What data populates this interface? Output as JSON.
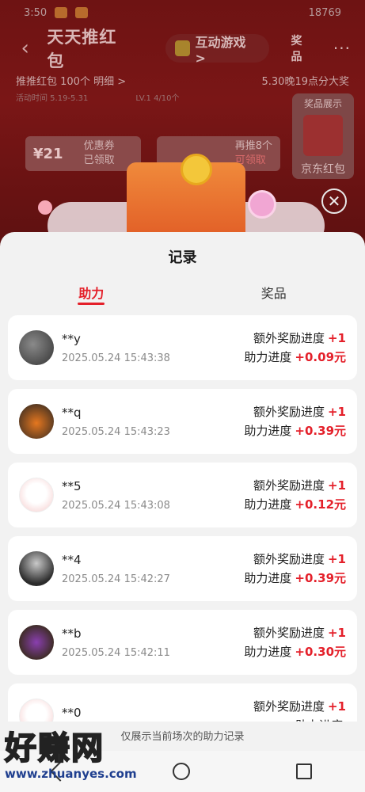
{
  "statusbar": {
    "time": "3:50",
    "battery": "18769"
  },
  "bg": {
    "title": "天天推红包",
    "game_btn": "互动游戏 >",
    "prize_btn": "奖品",
    "more": "···",
    "info_left": "推推红包 100个 明细 >",
    "info_right": "5.30晚19点分大奖",
    "activity_time": "活动时间 5.19-5.31",
    "level": "LV.1 4/10个",
    "coupon_amount": "¥21",
    "coupon_label": "优惠券",
    "coupon_status": "已领取",
    "coupon2_top": "再推8个",
    "coupon2_status": "可领取",
    "prize_side_title": "奖品展示",
    "prize_side_label": "京东红包"
  },
  "sheet": {
    "title": "记录",
    "tabs": [
      "助力",
      "奖品"
    ],
    "extra_label": "额外奖励进度",
    "help_label": "助力进度",
    "records": [
      {
        "name": "**y",
        "time": "2025.05.24 15:43:38",
        "extra": "+1",
        "help": "+0.09元"
      },
      {
        "name": "**q",
        "time": "2025.05.24 15:43:23",
        "extra": "+1",
        "help": "+0.39元"
      },
      {
        "name": "**5",
        "time": "2025.05.24 15:43:08",
        "extra": "+1",
        "help": "+0.12元"
      },
      {
        "name": "**4",
        "time": "2025.05.24 15:42:27",
        "extra": "+1",
        "help": "+0.39元"
      },
      {
        "name": "**b",
        "time": "2025.05.24 15:42:11",
        "extra": "+1",
        "help": "+0.30元"
      },
      {
        "name": "**0",
        "time": "",
        "extra": "+1",
        "help": ""
      }
    ],
    "footnote": "仅展示当前场次的助力记录"
  },
  "watermark": {
    "big": "好赚网",
    "url": "www.zhuanyes.com"
  }
}
